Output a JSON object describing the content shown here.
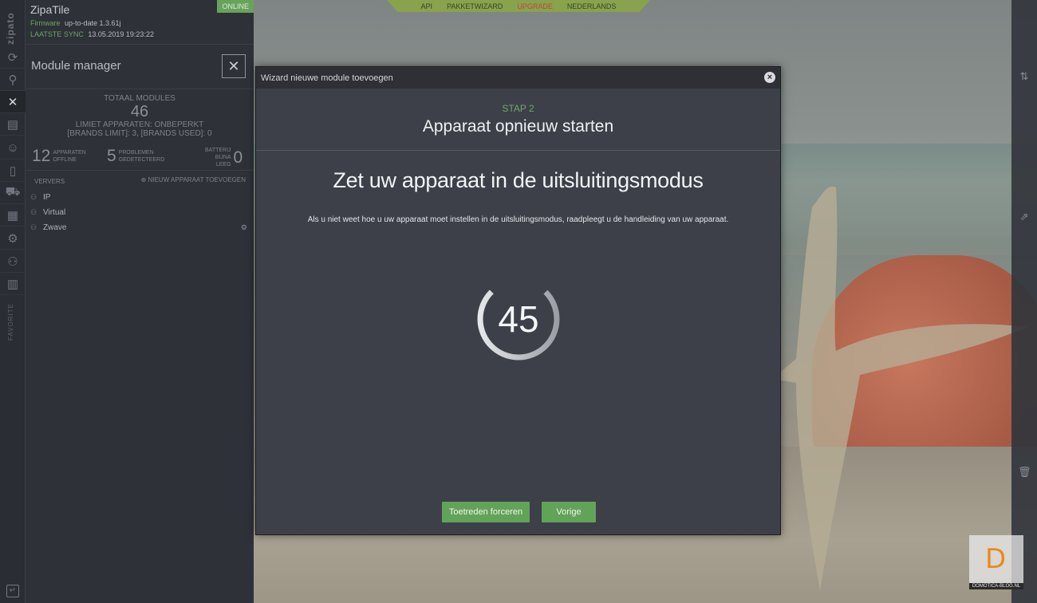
{
  "sidebar_icons": {
    "brand": "zipato",
    "items": [
      "refresh-icon",
      "search-icon",
      "module-manager-icon",
      "scenes-icon",
      "users-icon",
      "devices-icon",
      "vehicle-icon",
      "calendar-icon",
      "settings-icon",
      "network-icon",
      "clipboard-icon"
    ],
    "favorites": "FAVORITE"
  },
  "panel": {
    "device_name": "ZipaTile",
    "online": "ONLINE",
    "firmware_key": "Firmware",
    "firmware_value": "up-to-date 1.3.61j",
    "sync_key": "LAATSTE SYNC",
    "sync_value": "13.05.2019 19:23:22",
    "title": "Module manager",
    "stats": {
      "total_label": "TOTAAL MODULES",
      "total_value": "46",
      "limit_label": "LIMIET APPARATEN: ONBEPERKT",
      "brands_label": "[BRANDS LIMIT]: 3, [BRANDS USED]: 0",
      "offline_value": "12",
      "offline_label_1": "APPARATEN",
      "offline_label_2": "OFFLINE",
      "problems_value": "5",
      "problems_label_1": "PROBLEMEN",
      "problems_label_2": "GEDETECTEERD",
      "battery_label_1": "BATTERIJ",
      "battery_label_2": "BIJNA",
      "battery_label_3": "LEEG",
      "battery_value": "0"
    },
    "refresh": "VERVERS",
    "new_device": "NIEUW APPARAAT TOEVOEGEN",
    "tree": [
      "IP",
      "Virtual",
      "Zwave"
    ]
  },
  "topnav": {
    "api": "API",
    "wizard": "PAKKETWIZARD",
    "upgrade": "UPGRADE",
    "language": "NEDERLANDS"
  },
  "modal": {
    "title": "Wizard nieuwe module toevoegen",
    "step": "STAP 2",
    "step_title": "Apparaat opnieuw starten",
    "heading": "Zet uw apparaat in de uitsluitingsmodus",
    "description": "Als u niet weet hoe u uw apparaat moet instellen in de uitsluitingsmodus, raadpleegt u de handleiding van uw apparaat.",
    "countdown": "45",
    "countdown_progress": 0.75,
    "force_button": "Toetreden forceren",
    "prev_button": "Vorige"
  },
  "watermark": {
    "letter": "D",
    "text": "DOMOTICA-BLOG.NL"
  },
  "colors": {
    "accent_green": "#62a35a",
    "upgrade_red": "#c2463a"
  }
}
